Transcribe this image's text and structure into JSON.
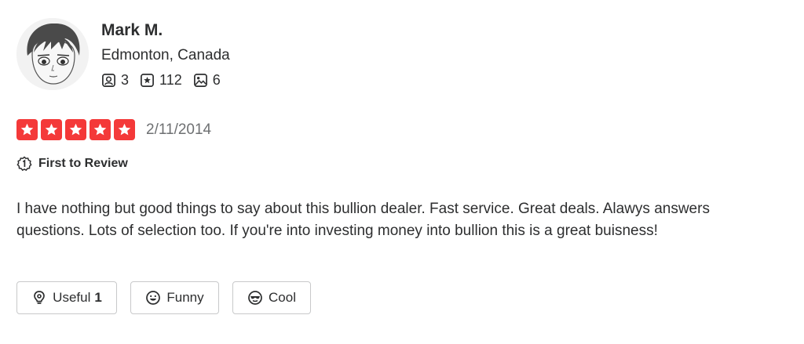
{
  "user": {
    "name": "Mark M.",
    "location": "Edmonton, Canada",
    "stats": {
      "friends": "3",
      "reviews": "112",
      "photos": "6"
    }
  },
  "rating": {
    "stars": 5,
    "max": 5,
    "date": "2/11/2014",
    "star_color": "#f43939"
  },
  "badge": {
    "label": "First to Review"
  },
  "review": {
    "text": "I have nothing but good things to say about this bullion dealer. Fast service. Great deals. Alawys answers questions. Lots of selection too. If you're into investing money into bullion this is a great buisness!"
  },
  "reactions": {
    "useful": {
      "label": "Useful",
      "count": "1"
    },
    "funny": {
      "label": "Funny"
    },
    "cool": {
      "label": "Cool"
    }
  },
  "icons": {
    "friends": "friends-icon",
    "reviews": "reviews-icon",
    "photos": "photos-icon",
    "badge": "first-review-icon",
    "useful": "lightbulb-icon",
    "funny": "smile-icon",
    "cool": "sunglasses-icon"
  }
}
